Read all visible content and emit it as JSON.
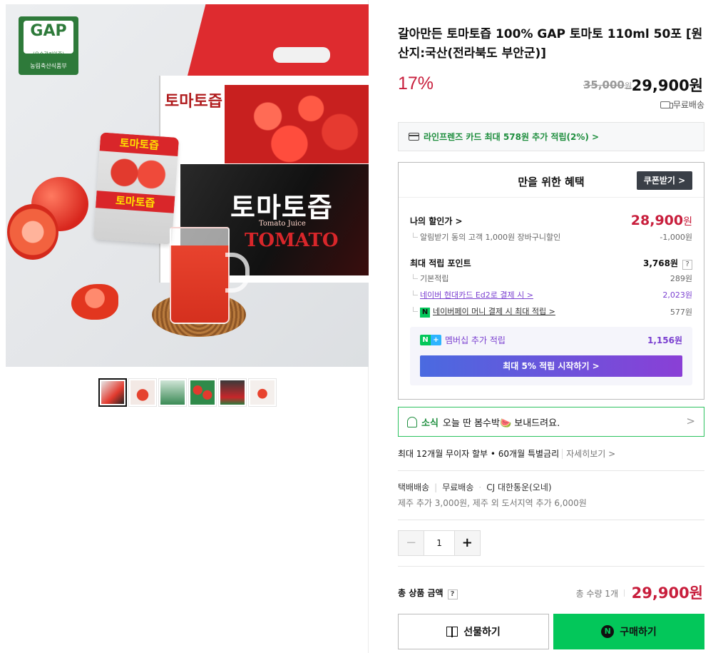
{
  "gallery": {
    "gap_badge": {
      "top": "GAP",
      "sub": "(우수관리인증)",
      "foot": "농림축산식품부"
    },
    "box_label": "토마토즙",
    "box_title": "토마토즙",
    "box_title_en": "Tomato Juice",
    "box_brand": "TOMATO",
    "pouch_top": "토마토즙",
    "pouch_mid": "토마토즙",
    "thumb_count": 6
  },
  "product": {
    "title": "갈아만든 토마토즙 100% GAP 토마토 110ml 50포 [원산지:국산(전라북도 부안군)]",
    "discount_rate": "17%",
    "original_price": "35,000",
    "original_won": "원",
    "sale_price": "29,900원",
    "shipping_badge": "무료배송"
  },
  "card_promo": "라인프렌즈 카드 최대 578원 추가 적립(2%) >",
  "benefit": {
    "title": "만을 위한 혜택",
    "coupon_button": "쿠폰받기 >",
    "my_discount_label": "나의 할인가 >",
    "my_discount_price": "28,900",
    "won": "원",
    "alarm_label": "알림받기 동의 고객 1,000원 장바구니할인",
    "alarm_value": "-1,000원",
    "points_label": "최대 적립 포인트",
    "points_value": "3,768원",
    "points_help": "?",
    "basic_label": "기본적립",
    "basic_value": "289원",
    "card_label": "네이버 현대카드 Ed2로 결제 시 >",
    "card_value": "2,023원",
    "npay_badge": "N",
    "npay_label": "네이버페이 머니 결제 시 최대 적립 >",
    "npay_value": "577원",
    "member_n": "N",
    "member_plus": "+",
    "member_label": "멤버십 추가 적립",
    "member_value": "1,156원",
    "member_button": "최대 5% 적립 시작하기 >"
  },
  "news": {
    "tag": "소식",
    "text": "오늘 딴 봄수박🍉 보내드려요.",
    "chevron": ">"
  },
  "installment": {
    "text": "최대 12개월 무이자 할부 • 60개월 특별금리",
    "more": "자세히보기 >"
  },
  "delivery": {
    "type": "택배배송",
    "fee": "무료배송",
    "carrier": "CJ 대한통운(오네)",
    "extra": "제주 추가 3,000원, 제주 외 도서지역 추가 6,000원"
  },
  "quantity": {
    "minus": "−",
    "value": "1",
    "plus": "+"
  },
  "total": {
    "label": "총 상품 금액",
    "help": "?",
    "count": "총 수량 1개",
    "price": "29,900원"
  },
  "actions": {
    "gift": "선물하기",
    "buy_icon": "N",
    "buy": "구매하기"
  },
  "colors": {
    "accent_red": "#c81e3c",
    "naver_green": "#03c75a",
    "membership_purple": "#7a3fd0"
  }
}
